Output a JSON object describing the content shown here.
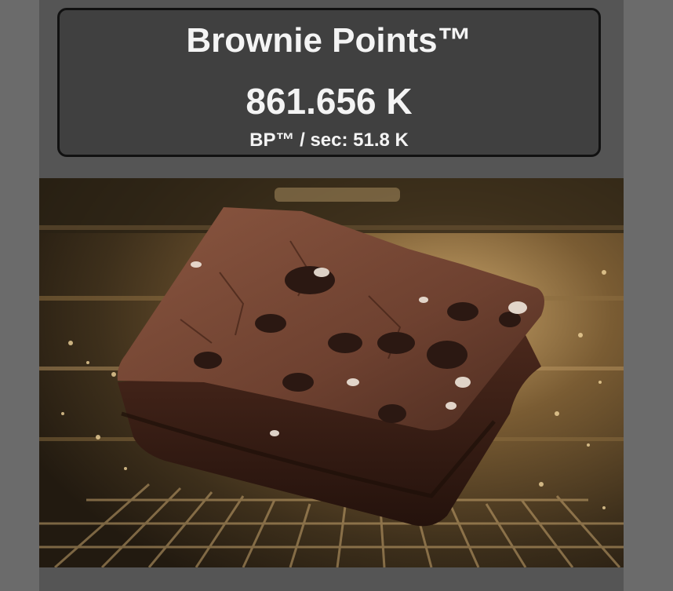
{
  "header": {
    "title": "Brownie Points™",
    "points_value": "861.656 K",
    "rate_label": "BP™ / sec:",
    "rate_value": "51.8 K"
  },
  "clicker": {
    "image": "brownie-in-oven",
    "colors": {
      "oven_dark": "#2e2415",
      "oven_mid": "#6e5430",
      "oven_light": "#d8b57a",
      "brownie_top": "#7a4a33",
      "brownie_side": "#3a1f16",
      "cookie_chunk": "#2b1812",
      "cream": "#efe6da"
    }
  }
}
